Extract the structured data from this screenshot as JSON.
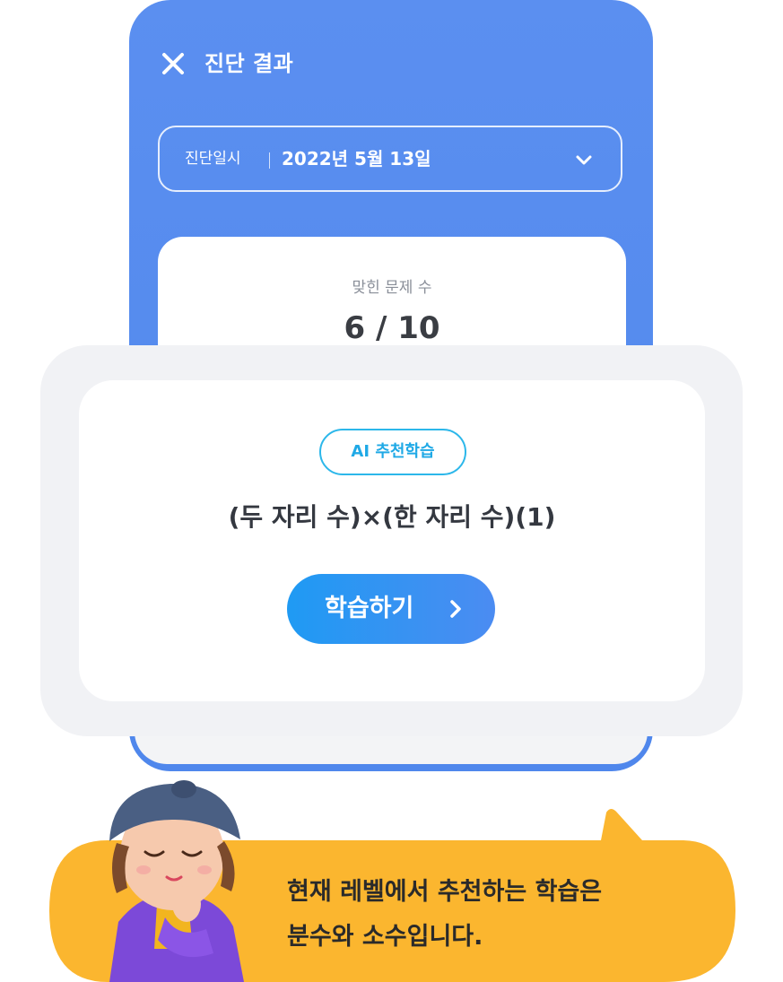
{
  "header": {
    "title": "진단 결과",
    "close_icon": "close-icon"
  },
  "date_selector": {
    "label": "진단일시",
    "value": "2022년 5월 13일",
    "icon": "chevron-down-icon"
  },
  "score": {
    "label": "맞힌 문제 수",
    "value": "6 / 10"
  },
  "recommendation": {
    "badge": "AI 추천학습",
    "topic": "(두 자리 수)×(한 자리 수)(1)",
    "button_label": "학습하기",
    "button_icon": "chevron-right-icon"
  },
  "speech": {
    "line1": "현재 레벨에서 추천하는 학습은",
    "line2": "분수와 소수입니다."
  },
  "colors": {
    "phone_bg": "#4f87ec",
    "badge_accent": "#2cb7ea",
    "button": "#1f9af3",
    "speech_bubble": "#fbb62f"
  }
}
